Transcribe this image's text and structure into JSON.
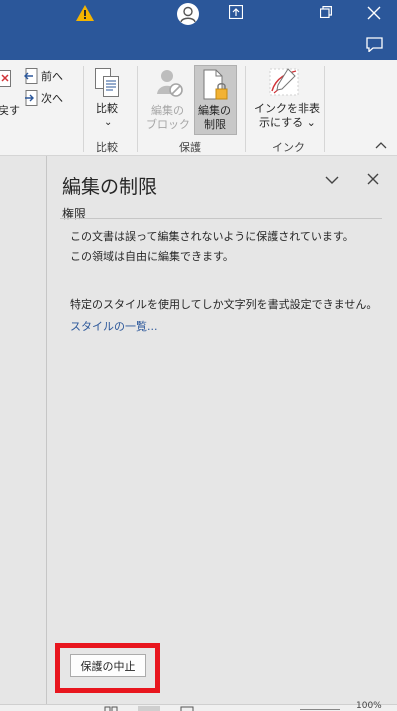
{
  "titlebar": {
    "icons": [
      "warning-icon",
      "account-avatar-icon",
      "ribbon-display-options-icon",
      "restore-icon",
      "close-icon",
      "comments-icon"
    ],
    "color": "#2b579a"
  },
  "ribbon": {
    "partial_label": "戻す",
    "previous_label": "前へ",
    "next_label": "次へ",
    "compare_button": [
      "比較",
      "⌄"
    ],
    "compare_group": "比較",
    "block_authors": [
      "編集の",
      "ブロック ⌄"
    ],
    "restrict_editing": [
      "編集の",
      "制限"
    ],
    "protect_group": "保護",
    "hide_ink": [
      "インクを非表",
      "示にする ⌄"
    ],
    "ink_group": "インク"
  },
  "pane": {
    "title": "編集の制限",
    "section_heading": "権限",
    "message_line1": "この文書は誤って編集されないように保護されています。",
    "message_line2": "この領域は自由に編集できます。",
    "style_message": "特定のスタイルを使用してしか文字列を書式設定できません。",
    "styles_link": "スタイルの一覧...",
    "stop_protection_button": "保護の中止"
  },
  "statusbar": {
    "zoom": "100%"
  },
  "colors": {
    "accent": "#2b579a",
    "highlight": "#e8161e",
    "link": "#2b579a"
  }
}
